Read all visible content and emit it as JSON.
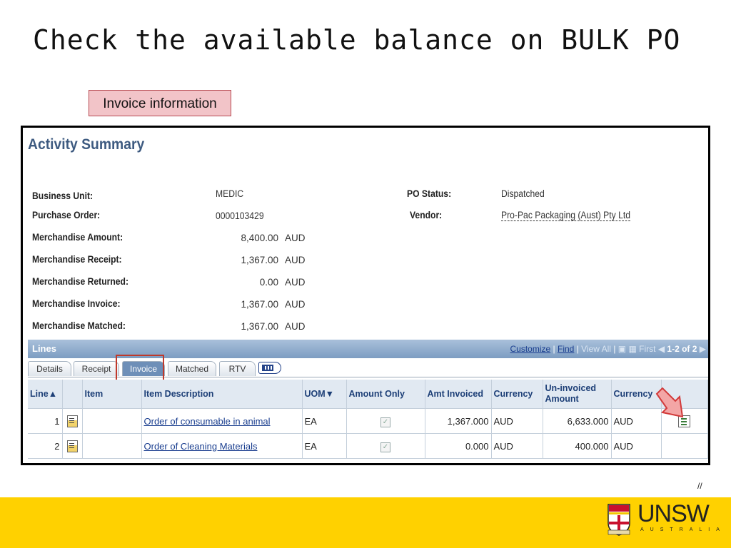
{
  "slide": {
    "title": "Check the available balance on BULK PO",
    "callout": "Invoice information",
    "page_mark": "//"
  },
  "panel": {
    "title": "Activity Summary",
    "fields": {
      "business_unit": {
        "label": "Business Unit:",
        "value": "MEDIC"
      },
      "purchase_order": {
        "label": "Purchase Order:",
        "value": "0000103429"
      },
      "po_status": {
        "label": "PO Status:",
        "value": "Dispatched"
      },
      "vendor": {
        "label": "Vendor:",
        "value": "Pro-Pac Packaging (Aust) Pty Ltd"
      },
      "merch_amount": {
        "label": "Merchandise Amount:",
        "value": "8,400.00",
        "currency": "AUD"
      },
      "merch_receipt": {
        "label": "Merchandise Receipt:",
        "value": "1,367.00",
        "currency": "AUD"
      },
      "merch_returned": {
        "label": "Merchandise Returned:",
        "value": "0.00",
        "currency": "AUD"
      },
      "merch_invoice": {
        "label": "Merchandise Invoice:",
        "value": "1,367.00",
        "currency": "AUD"
      },
      "merch_matched": {
        "label": "Merchandise Matched:",
        "value": "1,367.00",
        "currency": "AUD"
      }
    }
  },
  "lines": {
    "title": "Lines",
    "nav": {
      "customize": "Customize",
      "sep1": "|",
      "find": "Find",
      "sep2": "|",
      "view_all": "View All",
      "sep3": "|",
      "first": "First",
      "count": "1-2 of 2"
    },
    "tabs": [
      "Details",
      "Receipt",
      "Invoice",
      "Matched",
      "RTV"
    ],
    "active_tab": "Invoice",
    "columns": {
      "line": "Line",
      "item": "Item",
      "desc": "Item Description",
      "uom": "UOM",
      "amount_only": "Amount Only",
      "amt_invoiced": "Amt Invoiced",
      "currency": "Currency",
      "uninvoiced": "Un-invoiced Amount",
      "currency2": "Currency"
    },
    "rows": [
      {
        "line": "1",
        "item": "",
        "desc": "Order of consumable in animal",
        "uom": "EA",
        "amt_invoiced": "1,367.000",
        "currency": "AUD",
        "uninvoiced": "6,633.000",
        "currency2": "AUD"
      },
      {
        "line": "2",
        "item": "",
        "desc": "Order of Cleaning Materials",
        "uom": "EA",
        "amt_invoiced": "0.000",
        "currency": "AUD",
        "uninvoiced": "400.000",
        "currency2": "AUD"
      }
    ]
  },
  "brand": {
    "name": "UNSW",
    "sub": "AUSTRALIA",
    "footer_color": "#ffd100"
  }
}
